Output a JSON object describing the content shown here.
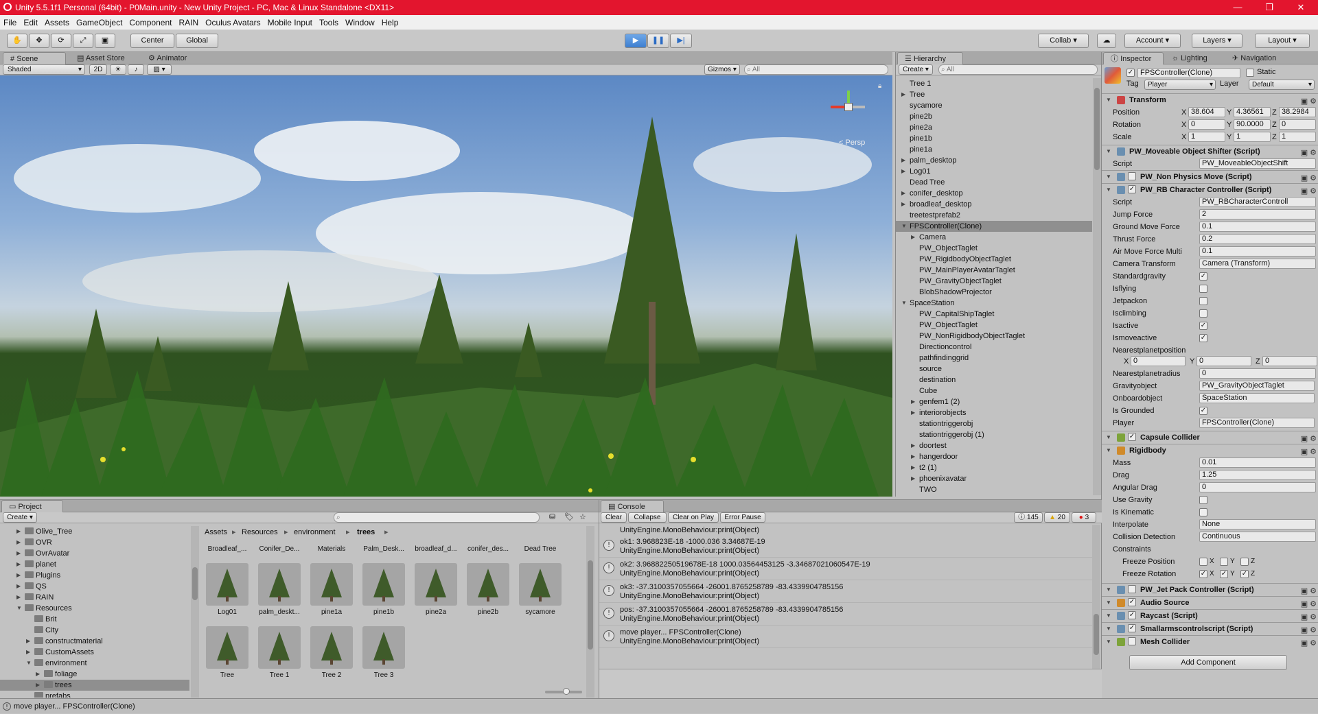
{
  "window": {
    "title": "Unity 5.5.1f1 Personal (64bit) - P0Main.unity - New Unity Project - PC, Mac & Linux Standalone <DX11>"
  },
  "menu": [
    "File",
    "Edit",
    "Assets",
    "GameObject",
    "Component",
    "RAIN",
    "Oculus Avatars",
    "Mobile Input",
    "Tools",
    "Window",
    "Help"
  ],
  "toolbar": {
    "center": "Center",
    "global": "Global",
    "collab": "Collab",
    "account": "Account",
    "layers": "Layers",
    "layout": "Layout"
  },
  "scene": {
    "tabs": [
      "Scene",
      "Asset Store",
      "Animator"
    ],
    "shading": "Shaded",
    "mode2d": "2D",
    "gizmos": "Gizmos",
    "search_placeholder": "All",
    "persp": "Persp"
  },
  "hierarchy": {
    "tab": "Hierarchy",
    "create": "Create",
    "search_placeholder": "All",
    "items": [
      {
        "t": "Tree 1",
        "i": 0,
        "a": ""
      },
      {
        "t": "Tree",
        "i": 0,
        "a": "r"
      },
      {
        "t": "sycamore",
        "i": 0,
        "a": ""
      },
      {
        "t": "pine2b",
        "i": 0,
        "a": ""
      },
      {
        "t": "pine2a",
        "i": 0,
        "a": ""
      },
      {
        "t": "pine1b",
        "i": 0,
        "a": ""
      },
      {
        "t": "pine1a",
        "i": 0,
        "a": ""
      },
      {
        "t": "palm_desktop",
        "i": 0,
        "a": "r"
      },
      {
        "t": "Log01",
        "i": 0,
        "a": "r"
      },
      {
        "t": "Dead Tree",
        "i": 0,
        "a": ""
      },
      {
        "t": "conifer_desktop",
        "i": 0,
        "a": "r"
      },
      {
        "t": "broadleaf_desktop",
        "i": 0,
        "a": "r"
      },
      {
        "t": "treetestprefab2",
        "i": 0,
        "a": ""
      },
      {
        "t": "FPSController(Clone)",
        "i": 0,
        "a": "d",
        "sel": true
      },
      {
        "t": "Camera",
        "i": 1,
        "a": "r"
      },
      {
        "t": "PW_ObjectTaglet",
        "i": 1,
        "a": ""
      },
      {
        "t": "PW_RigidbodyObjectTaglet",
        "i": 1,
        "a": ""
      },
      {
        "t": "PW_MainPlayerAvatarTaglet",
        "i": 1,
        "a": ""
      },
      {
        "t": "PW_GravityObjectTaglet",
        "i": 1,
        "a": ""
      },
      {
        "t": "BlobShadowProjector",
        "i": 1,
        "a": ""
      },
      {
        "t": "SpaceStation",
        "i": 0,
        "a": "d"
      },
      {
        "t": "PW_CapitalShipTaglet",
        "i": 1,
        "a": ""
      },
      {
        "t": "PW_ObjectTaglet",
        "i": 1,
        "a": ""
      },
      {
        "t": "PW_NonRigidbodyObjectTaglet",
        "i": 1,
        "a": ""
      },
      {
        "t": "Directioncontrol",
        "i": 1,
        "a": ""
      },
      {
        "t": "pathfindinggrid",
        "i": 1,
        "a": ""
      },
      {
        "t": "source",
        "i": 1,
        "a": ""
      },
      {
        "t": "destination",
        "i": 1,
        "a": ""
      },
      {
        "t": "Cube",
        "i": 1,
        "a": ""
      },
      {
        "t": "genfem1 (2)",
        "i": 1,
        "a": "r"
      },
      {
        "t": "interiorobjects",
        "i": 1,
        "a": "r"
      },
      {
        "t": "stationtriggerobj",
        "i": 1,
        "a": ""
      },
      {
        "t": "stationtriggerobj (1)",
        "i": 1,
        "a": ""
      },
      {
        "t": "doortest",
        "i": 1,
        "a": "r"
      },
      {
        "t": "hangerdoor",
        "i": 1,
        "a": "r"
      },
      {
        "t": "t2 (1)",
        "i": 1,
        "a": "r"
      },
      {
        "t": "phoenixavatar",
        "i": 1,
        "a": "r"
      },
      {
        "t": "TWO",
        "i": 1,
        "a": ""
      }
    ]
  },
  "inspector": {
    "tabs": [
      "Inspector",
      "Lighting",
      "Navigation"
    ],
    "object_name": "FPSController(Clone)",
    "static_label": "Static",
    "tag_label": "Tag",
    "tag": "Player",
    "layer_label": "Layer",
    "layer": "Default",
    "transform": {
      "title": "Transform",
      "rows": [
        {
          "label": "Position",
          "x": "38.604",
          "y": "4.36561",
          "z": "38.2984"
        },
        {
          "label": "Rotation",
          "x": "0",
          "y": "90.0000",
          "z": "0"
        },
        {
          "label": "Scale",
          "x": "1",
          "y": "1",
          "z": "1"
        }
      ]
    },
    "shifter": {
      "title": "PW_Moveable Object Shifter (Script)",
      "script_label": "Script",
      "script": "PW_MoveableObjectShift"
    },
    "nonphys": {
      "title": "PW_Non Physics Move (Script)"
    },
    "rbcc": {
      "title": "PW_RB Character Controller (Script)",
      "script_label": "Script",
      "script": "PW_RBCharacterControll",
      "fields": [
        {
          "label": "Jump Force",
          "value": "2"
        },
        {
          "label": "Ground Move Force",
          "value": "0.1"
        },
        {
          "label": "Thrust Force",
          "value": "0.2"
        },
        {
          "label": "Air Move Force Multi",
          "value": "0.1"
        },
        {
          "label": "Camera Transform",
          "value": "Camera (Transform)"
        }
      ],
      "checks": [
        {
          "label": "Standardgravity",
          "on": true
        },
        {
          "label": "Isflying",
          "on": false
        },
        {
          "label": "Jetpackon",
          "on": false
        },
        {
          "label": "Isclimbing",
          "on": false
        },
        {
          "label": "Isactive",
          "on": true
        },
        {
          "label": "Ismoveactive",
          "on": true
        }
      ],
      "nearest_label": "Nearestplanetposition",
      "nx": "0",
      "ny": "0",
      "nz": "0",
      "radius_label": "Nearestplanetradius",
      "radius": "0",
      "grav_label": "Gravityobject",
      "grav": "PW_GravityObjectTaglet",
      "onboard_label": "Onboardobject",
      "onboard": "SpaceStation",
      "grounded_label": "Is Grounded",
      "player_label": "Player",
      "player": "FPSController(Clone)"
    },
    "capsule": {
      "title": "Capsule Collider"
    },
    "rigidbody": {
      "title": "Rigidbody",
      "fields": [
        {
          "label": "Mass",
          "value": "0.01"
        },
        {
          "label": "Drag",
          "value": "1.25"
        },
        {
          "label": "Angular Drag",
          "value": "0"
        }
      ],
      "use_gravity": "Use Gravity",
      "is_kinematic": "Is Kinematic",
      "interp_label": "Interpolate",
      "interp": "None",
      "coll_label": "Collision Detection",
      "coll": "Continuous",
      "constraints": "Constraints",
      "freeze_pos": "Freeze Position",
      "freeze_rot": "Freeze Rotation"
    },
    "more": [
      {
        "title": "PW_Jet Pack Controller (Script)",
        "on": false,
        "color": "#6a8fb0"
      },
      {
        "title": "Audio Source",
        "on": true,
        "color": "#d08a2a"
      },
      {
        "title": "Raycast (Script)",
        "on": true,
        "color": "#6a8fb0"
      },
      {
        "title": "Smallarmscontrolscript (Script)",
        "on": true,
        "color": "#6a8fb0"
      },
      {
        "title": "Mesh Collider",
        "on": false,
        "color": "#7da33a"
      }
    ],
    "add_component": "Add Component"
  },
  "project": {
    "tab": "Project",
    "create": "Create",
    "tree": [
      {
        "t": "Olive_Tree",
        "i": 1,
        "a": "r"
      },
      {
        "t": "OVR",
        "i": 1,
        "a": "r"
      },
      {
        "t": "OvrAvatar",
        "i": 1,
        "a": "r"
      },
      {
        "t": "planet",
        "i": 1,
        "a": "r"
      },
      {
        "t": "Plugins",
        "i": 1,
        "a": "r"
      },
      {
        "t": "QS",
        "i": 1,
        "a": "r"
      },
      {
        "t": "RAIN",
        "i": 1,
        "a": "r"
      },
      {
        "t": "Resources",
        "i": 1,
        "a": "d"
      },
      {
        "t": "Brit",
        "i": 2,
        "a": ""
      },
      {
        "t": "City",
        "i": 2,
        "a": ""
      },
      {
        "t": "constructmaterial",
        "i": 2,
        "a": "r"
      },
      {
        "t": "CustomAssets",
        "i": 2,
        "a": "r"
      },
      {
        "t": "environment",
        "i": 2,
        "a": "d"
      },
      {
        "t": "foliage",
        "i": 3,
        "a": "r"
      },
      {
        "t": "trees",
        "i": 3,
        "a": "r",
        "sel": true
      },
      {
        "t": "prefabs",
        "i": 2,
        "a": ""
      }
    ],
    "breadcrumb": [
      "Assets",
      "Resources",
      "environment",
      "trees"
    ],
    "folders": [
      "Broadleaf_...",
      "Conifer_De...",
      "Materials",
      "Palm_Desk...",
      "broadleaf_d...",
      "conifer_des...",
      "Dead Tree"
    ],
    "assets_row1": [
      "Log01",
      "palm_deskt...",
      "pine1a",
      "pine1b",
      "pine2a",
      "pine2b",
      "sycamore"
    ],
    "assets_row2": [
      "Tree",
      "Tree 1",
      "Tree 2",
      "Tree 3"
    ]
  },
  "console": {
    "tab": "Console",
    "buttons": [
      "Clear",
      "Collapse",
      "Clear on Play",
      "Error Pause"
    ],
    "counts": {
      "info": "145",
      "warn": "20",
      "error": "3"
    },
    "top_line": "UnityEngine.MonoBehaviour:print(Object)",
    "entries": [
      {
        "l1": "ok1: 3.968823E-18 -1000.036 3.34687E-19",
        "l2": "UnityEngine.MonoBehaviour:print(Object)"
      },
      {
        "l1": "ok2: 3.96882250519678E-18 1000.03564453125 -3.34687021060547E-19",
        "l2": "UnityEngine.MonoBehaviour:print(Object)"
      },
      {
        "l1": "ok3: -37.3100357055664 -26001.8765258789 -83.4339904785156",
        "l2": "UnityEngine.MonoBehaviour:print(Object)"
      },
      {
        "l1": "pos: -37.3100357055664 -26001.8765258789 -83.4339904785156",
        "l2": "UnityEngine.MonoBehaviour:print(Object)"
      },
      {
        "l1": "move player... FPSController(Clone)",
        "l2": "UnityEngine.MonoBehaviour:print(Object)"
      }
    ]
  },
  "status": "move player... FPSController(Clone)"
}
